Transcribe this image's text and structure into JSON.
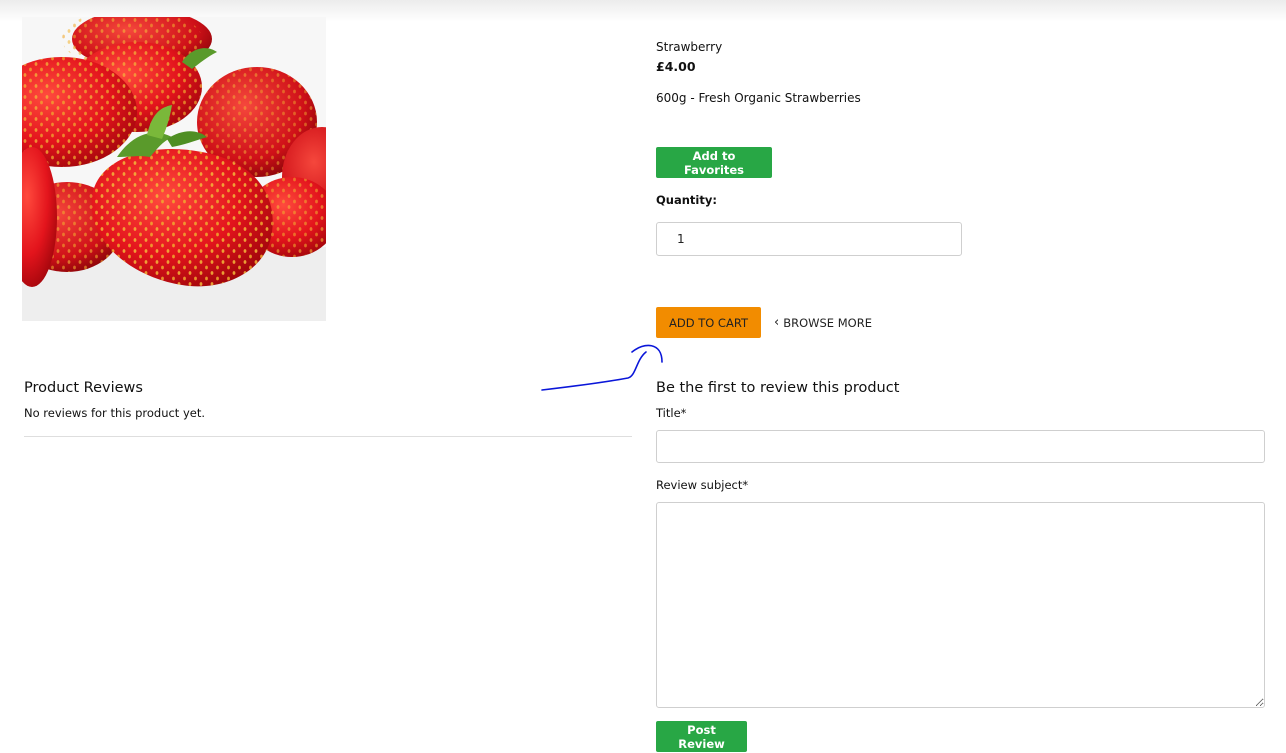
{
  "product": {
    "name": "Strawberry",
    "price": "£4.00",
    "description": "600g - Fresh Organic Strawberries",
    "image_icon": "strawberries-photo"
  },
  "actions": {
    "favorites_label": "Add to Favorites",
    "quantity_label": "Quantity:",
    "quantity_value": "1",
    "add_to_cart_label": "ADD TO CART",
    "browse_more_label": "BROWSE MORE",
    "browse_more_icon": "chevron-left-icon"
  },
  "reviews": {
    "title": "Product Reviews",
    "empty_text": "No reviews for this product yet."
  },
  "review_form": {
    "title": "Be the first to review this product",
    "title_label": "Title*",
    "title_value": "",
    "subject_label": "Review subject*",
    "subject_value": "",
    "submit_label": "Post Review"
  },
  "colors": {
    "green": "#28a745",
    "orange": "#f28c00",
    "annotation": "#0a16d9"
  }
}
